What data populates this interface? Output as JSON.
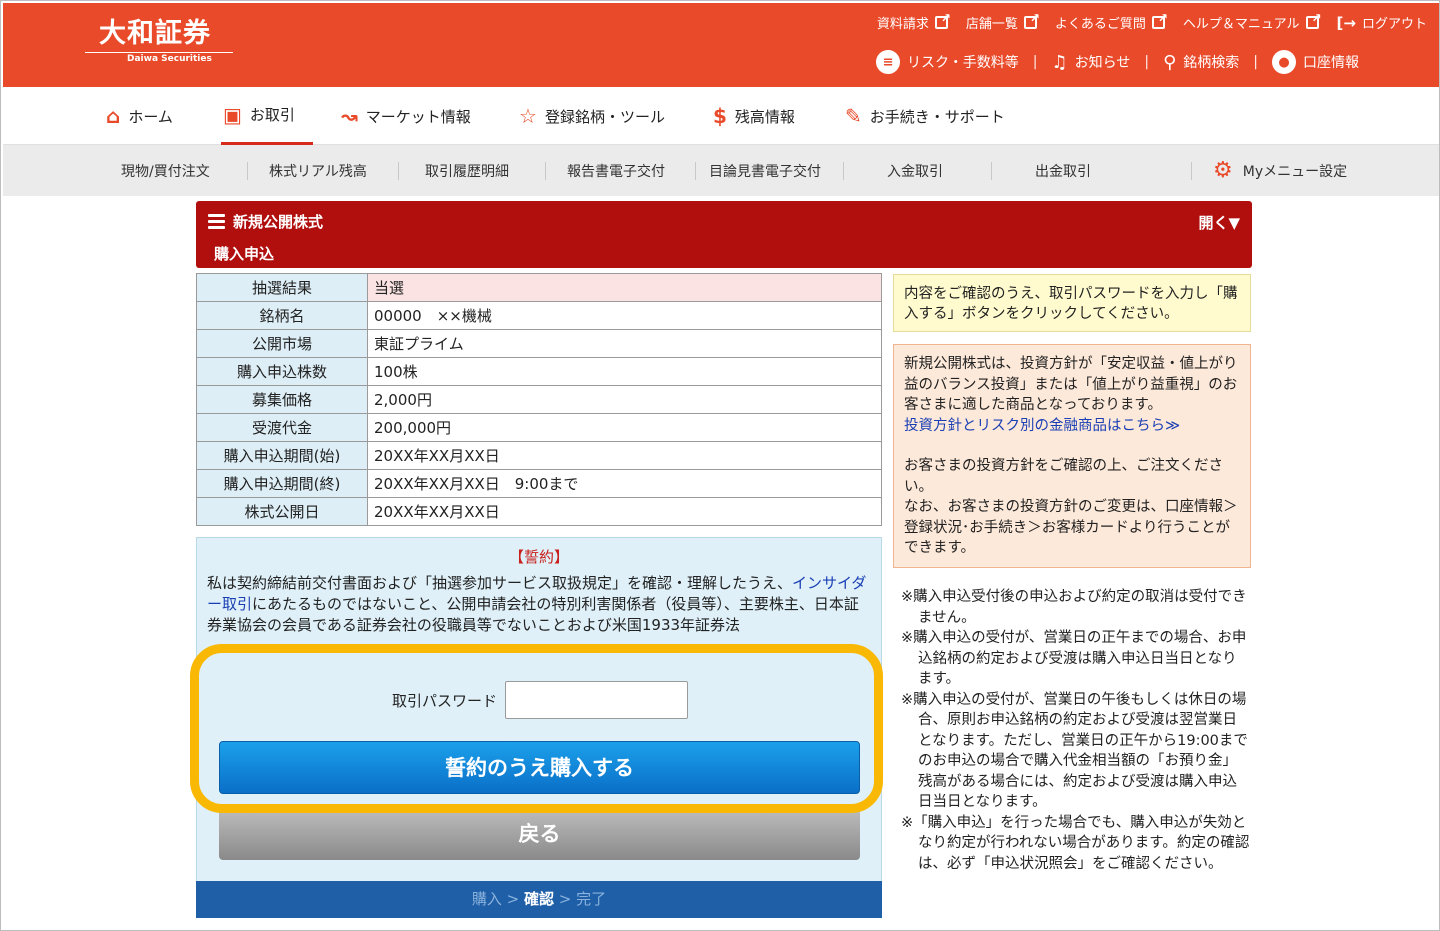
{
  "header": {
    "logo_main": "大和証券",
    "logo_sub": "Daiwa Securities",
    "top_links": [
      "資料請求",
      "店舗一覧",
      "よくあるご質問",
      "ヘルプ＆マニュアル"
    ],
    "logout": "ログアウト",
    "second_links": {
      "risk": "リスク・手数料等",
      "notice": "お知らせ",
      "search": "銘柄検索",
      "account": "口座情報"
    }
  },
  "main_nav": [
    "ホーム",
    "お取引",
    "マーケット情報",
    "登録銘柄・ツール",
    "残高情報",
    "お手続き・サポート"
  ],
  "sub_nav": [
    "現物/買付注文",
    "株式リアル残高",
    "取引履歴明細",
    "報告書電子交付",
    "目論見書電子交付",
    "入金取引",
    "出金取引"
  ],
  "my_menu": "Myメニュー設定",
  "section": {
    "title": "新規公開株式",
    "subtitle": "購入申込",
    "open": "開く▼"
  },
  "info_rows": [
    {
      "label": "抽選結果",
      "value": "当選"
    },
    {
      "label": "銘柄名",
      "value": "00000　××機械"
    },
    {
      "label": "公開市場",
      "value": "東証プライム"
    },
    {
      "label": "購入申込株数",
      "value": "100株"
    },
    {
      "label": "募集価格",
      "value": "2,000円"
    },
    {
      "label": "受渡代金",
      "value": "200,000円"
    },
    {
      "label": "購入申込期間(始)",
      "value": "20XX年XX月XX日"
    },
    {
      "label": "購入申込期間(終)",
      "value": "20XX年XX月XX日　9:00まで"
    },
    {
      "label": "株式公開日",
      "value": "20XX年XX月XX日"
    }
  ],
  "notes": {
    "yellow": "内容をご確認のうえ、取引パスワードを入力し「購入する」ボタンをクリックしてください。",
    "orange_p1": "新規公開株式は、投資方針が「安定収益・値上がり益のバランス投資」または「値上がり益重視」のお客さまに適した商品となっております。",
    "orange_link": "投資方針とリスク別の金融商品はこちら≫",
    "orange_p2": "お客さまの投資方針をご確認の上、ご注文ください。",
    "orange_p3": "なお、お客さまの投資方針のご変更は、口座情報＞登録状況･お手続き＞お客様カードより行うことができます。",
    "list": [
      "※購入申込受付後の申込および約定の取消は受付できません。",
      "※購入申込の受付が、営業日の正午までの場合、お申込銘柄の約定および受渡は購入申込日当日となります。",
      "※購入申込の受付が、営業日の午後もしくは休日の場合、原則お申込銘柄の約定および受渡は翌営業日となります。ただし、営業日の正午から19:00までのお申込の場合で購入代金相当額の「お預り金」残高がある場合には、約定および受渡は購入申込日当日となります。",
      "※「購入申込」を行った場合でも、購入申込が失効となり約定が行われない場合があります。約定の確認は、必ず「申込状況照会」をご確認ください。"
    ]
  },
  "consent": {
    "title": "【誓約】",
    "text_a": "私は契約締結前交付書面および「抽選参加サービス取扱規定」を確認・理解したうえ、",
    "link": "インサイダー取引",
    "text_b": "にあたるものではないこと、公開申請会社の特別利害関係者（役員等）、主要株主、日本証券業協会の会員である証券会社の役職員等でないことおよび米国1933年証券法"
  },
  "password": {
    "label": "取引パスワード",
    "value": ""
  },
  "buttons": {
    "submit": "誓約のうえ購入する",
    "back": "戻る"
  },
  "steps": {
    "s1": "購入",
    "sep": " > ",
    "s2": "確認",
    "s3": "完了"
  },
  "colors": {
    "brand": "#e94a2a",
    "section_bar": "#b10e0e",
    "primary_button": "#0a6fc8",
    "highlight": "#f9b804"
  }
}
